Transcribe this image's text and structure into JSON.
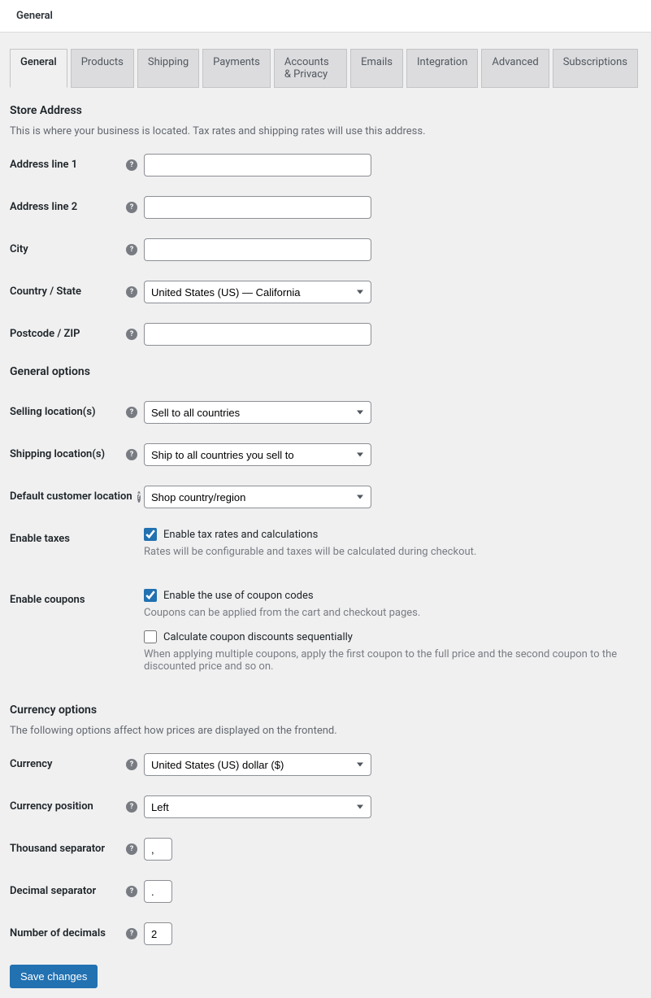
{
  "header": {
    "title": "General"
  },
  "tabs": [
    {
      "label": "General",
      "active": true
    },
    {
      "label": "Products",
      "active": false
    },
    {
      "label": "Shipping",
      "active": false
    },
    {
      "label": "Payments",
      "active": false
    },
    {
      "label": "Accounts & Privacy",
      "active": false
    },
    {
      "label": "Emails",
      "active": false
    },
    {
      "label": "Integration",
      "active": false
    },
    {
      "label": "Advanced",
      "active": false
    },
    {
      "label": "Subscriptions",
      "active": false
    }
  ],
  "sections": {
    "store_address": {
      "heading": "Store Address",
      "description": "This is where your business is located. Tax rates and shipping rates will use this address.",
      "fields": {
        "address1": {
          "label": "Address line 1",
          "value": ""
        },
        "address2": {
          "label": "Address line 2",
          "value": ""
        },
        "city": {
          "label": "City",
          "value": ""
        },
        "country_state": {
          "label": "Country / State",
          "value": "United States (US) — California"
        },
        "postcode": {
          "label": "Postcode / ZIP",
          "value": ""
        }
      }
    },
    "general_options": {
      "heading": "General options",
      "fields": {
        "selling_locations": {
          "label": "Selling location(s)",
          "value": "Sell to all countries"
        },
        "shipping_locations": {
          "label": "Shipping location(s)",
          "value": "Ship to all countries you sell to"
        },
        "default_customer_location": {
          "label": "Default customer location",
          "value": "Shop country/region"
        },
        "enable_taxes": {
          "label": "Enable taxes",
          "checkbox_label": "Enable tax rates and calculations",
          "help": "Rates will be configurable and taxes will be calculated during checkout.",
          "checked": true
        },
        "enable_coupons": {
          "label": "Enable coupons",
          "checkbox1_label": "Enable the use of coupon codes",
          "help1": "Coupons can be applied from the cart and checkout pages.",
          "checked1": true,
          "checkbox2_label": "Calculate coupon discounts sequentially",
          "help2": "When applying multiple coupons, apply the first coupon to the full price and the second coupon to the discounted price and so on.",
          "checked2": false
        }
      }
    },
    "currency_options": {
      "heading": "Currency options",
      "description": "The following options affect how prices are displayed on the frontend.",
      "fields": {
        "currency": {
          "label": "Currency",
          "value": "United States (US) dollar ($)"
        },
        "currency_position": {
          "label": "Currency position",
          "value": "Left"
        },
        "thousand_separator": {
          "label": "Thousand separator",
          "value": ","
        },
        "decimal_separator": {
          "label": "Decimal separator",
          "value": "."
        },
        "number_of_decimals": {
          "label": "Number of decimals",
          "value": "2"
        }
      }
    }
  },
  "actions": {
    "save_label": "Save changes"
  }
}
